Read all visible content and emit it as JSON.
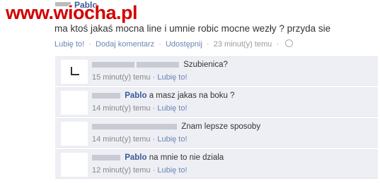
{
  "watermark": "www.wiocha.pl",
  "post": {
    "author": "Pablo",
    "text": "ma ktoś jakaś mocna line i umnie robic mocne wezły ? przyda sie",
    "actions": {
      "like": "Lubię to!",
      "comment": "Dodaj komentarz",
      "share": "Udostępnij",
      "time": "23 minut(y) temu",
      "sep": "·"
    }
  },
  "comments": [
    {
      "author": "",
      "text": "Szubienica?",
      "time": "15 minut(y) temu",
      "like": "Lubię to!",
      "sep": "·"
    },
    {
      "author": "Pablo",
      "text": "a masz jakas na boku ?",
      "time": "14 minut(y) temu",
      "like": "Lubię to!",
      "sep": "·"
    },
    {
      "author": "",
      "text": "Znam lepsze sposoby",
      "time": "14 minut(y) temu",
      "like": "Lubię to!",
      "sep": "·"
    },
    {
      "author": "Pablo",
      "text": "na mnie to nie dziala",
      "time": "12 minut(y) temu",
      "like": "Lubię to!",
      "sep": "·"
    }
  ],
  "colors": {
    "watermark": "#d30000",
    "link": "#6d84b4",
    "author": "#3b5998",
    "comment_bg": "#edeff4"
  },
  "icons": {
    "privacy": "globe-icon",
    "like": "thumbs-up-icon"
  }
}
